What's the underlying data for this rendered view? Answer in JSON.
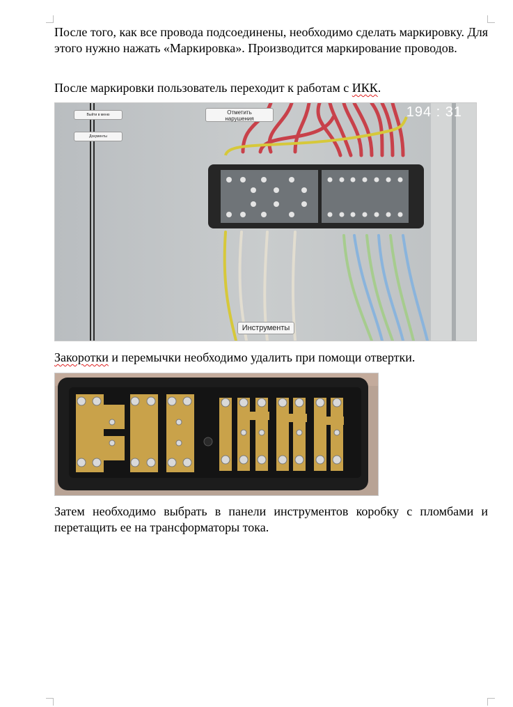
{
  "paragraphs": {
    "p1": "После того, как все провода подсоединены, необходимо сделать маркировку. Для этого нужно нажать «Маркировка». Производится маркирование проводов.",
    "p2_before": "После маркировки пользователь переходит к работам с ",
    "p2_abbr": "ИКК",
    "p2_after": ".",
    "p3_word": "Закоротки",
    "p3_rest": " и перемычки необходимо удалить при помощи отвертки.",
    "p4": "Затем необходимо выбрать в панели инструментов коробку с пломбами и перетащить ее на трансформаторы тока."
  },
  "sim": {
    "exit_menu_label": "Выйти в меню",
    "documents_label": "Документы",
    "mark_violations_line1": "Отметить",
    "mark_violations_line2": "нарушения",
    "timer": "194 : 31",
    "tools_label": "Инструменты"
  },
  "colors": {
    "wire_red": "#c8414a",
    "wire_yellow": "#d6c83a",
    "wire_blue": "#8ab4dc",
    "wire_green": "#a6cc8e",
    "wire_white": "#e2ddd0",
    "brass": "#c9a24a"
  }
}
